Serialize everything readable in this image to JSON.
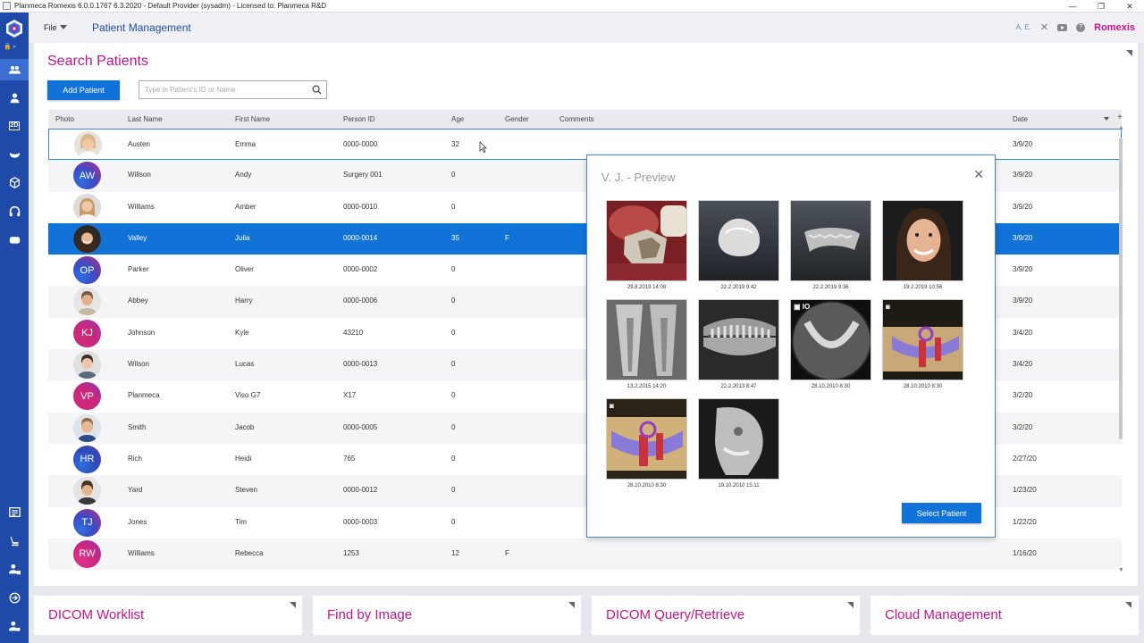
{
  "window": {
    "title": "Planmeca Romexis 6.0.0.1767 6.3.2020 - Default Provider (sysadm) - Licensed to: Planmeca R&D",
    "buttons": [
      "—",
      "❐",
      "✕"
    ]
  },
  "sidebar": {
    "items": [
      {
        "icon": "patients-icon",
        "active": true
      },
      {
        "icon": "person-icon"
      },
      {
        "icon": "2d-icon",
        "text": "2D"
      },
      {
        "icon": "tooth-icon"
      },
      {
        "icon": "3d-cube-icon"
      },
      {
        "icon": "headphones-icon"
      },
      {
        "icon": "camera-icon"
      },
      {
        "icon": "worklist-icon"
      },
      {
        "icon": "dental-chair-icon"
      },
      {
        "icon": "user-admin-icon"
      },
      {
        "icon": "login-icon"
      },
      {
        "icon": "settings-user-icon"
      }
    ]
  },
  "topbar": {
    "file_label": "File",
    "module_title": "Patient Management",
    "user_initials": "A. E.",
    "brand": "Romexis"
  },
  "search": {
    "title": "Search Patients",
    "add_label": "Add Patient",
    "placeholder": "Type in Patient's ID or Name"
  },
  "table": {
    "headers": {
      "photo": "Photo",
      "last_name": "Last Name",
      "first_name": "First Name",
      "person_id": "Person ID",
      "age": "Age",
      "gender": "Gender",
      "comments": "Comments",
      "date": "Date"
    },
    "rows": [
      {
        "initials": "",
        "last": "Austen",
        "first": "Emma",
        "pid": "0000-0000",
        "age": "32",
        "gender": "",
        "date": "3/9/20"
      },
      {
        "initials": "AW",
        "last": "Willson",
        "first": "Andy",
        "pid": "Surgery 001",
        "age": "0",
        "gender": "",
        "date": "3/9/20"
      },
      {
        "initials": "",
        "last": "Williams",
        "first": "Amber",
        "pid": "0000-0010",
        "age": "0",
        "gender": "",
        "date": "3/9/20"
      },
      {
        "initials": "",
        "last": "Valley",
        "first": "Julia",
        "pid": "0000-0014",
        "age": "35",
        "gender": "F",
        "date": "3/9/20"
      },
      {
        "initials": "OP",
        "last": "Parker",
        "first": "Oliver",
        "pid": "0000-0002",
        "age": "0",
        "gender": "",
        "date": "3/9/20"
      },
      {
        "initials": "",
        "last": "Abbey",
        "first": "Harry",
        "pid": "0000-0006",
        "age": "0",
        "gender": "",
        "date": "3/9/20"
      },
      {
        "initials": "KJ",
        "last": "Johnson",
        "first": "Kyle",
        "pid": "43210",
        "age": "0",
        "gender": "",
        "date": "3/4/20"
      },
      {
        "initials": "",
        "last": "Wilson",
        "first": "Lucas",
        "pid": "0000-0013",
        "age": "0",
        "gender": "",
        "date": "3/4/20"
      },
      {
        "initials": "VP",
        "last": "Planmeca",
        "first": "Viso G7",
        "pid": "X17",
        "age": "0",
        "gender": "",
        "date": "3/2/20"
      },
      {
        "initials": "",
        "last": "Smith",
        "first": "Jacob",
        "pid": "0000-0005",
        "age": "0",
        "gender": "",
        "date": "3/2/20"
      },
      {
        "initials": "HR",
        "last": "Rich",
        "first": "Heidi",
        "pid": "765",
        "age": "0",
        "gender": "",
        "date": "2/27/20"
      },
      {
        "initials": "",
        "last": "Yard",
        "first": "Steven",
        "pid": "0000-0012",
        "age": "0",
        "gender": "",
        "date": "1/23/20"
      },
      {
        "initials": "TJ",
        "last": "Jones",
        "first": "Tim",
        "pid": "0000-0003",
        "age": "0",
        "gender": "",
        "date": "1/22/20"
      },
      {
        "initials": "RW",
        "last": "Williams",
        "first": "Rebecca",
        "pid": "1253",
        "age": "12",
        "gender": "F",
        "date": "1/16/20"
      }
    ]
  },
  "preview": {
    "title": "V. J. - Preview",
    "select_label": "Select Patient",
    "thumbs": [
      {
        "kind": "intraoral-photo",
        "date": "29.8.2019 14:08"
      },
      {
        "kind": "crown-model",
        "date": "22.2.2019 9:42"
      },
      {
        "kind": "jaw-scan",
        "date": "22.2.2019 9:36"
      },
      {
        "kind": "face-photo",
        "date": "19.2.2019 10:56"
      },
      {
        "kind": "intraoral-xray",
        "date": "13.2.2015 14:20"
      },
      {
        "kind": "panoramic-xray",
        "date": "22.2.2013 8:47"
      },
      {
        "kind": "cbct-io",
        "badge": "IO",
        "date": "28.10.2010 8:30"
      },
      {
        "kind": "implant-3d",
        "date": "28.10.2010 8:30"
      },
      {
        "kind": "implant-3d-2",
        "date": "28.10.2010 8:30"
      },
      {
        "kind": "ceph-xray",
        "date": "19.10.2010 15:11"
      }
    ]
  },
  "bottom_tiles": [
    "DICOM Worklist",
    "Find by Image",
    "DICOM Query/Retrieve",
    "Cloud Management"
  ],
  "colors": {
    "accent": "#1172d8",
    "brand": "#c0158a",
    "sidebar": "#1f4aa8"
  }
}
